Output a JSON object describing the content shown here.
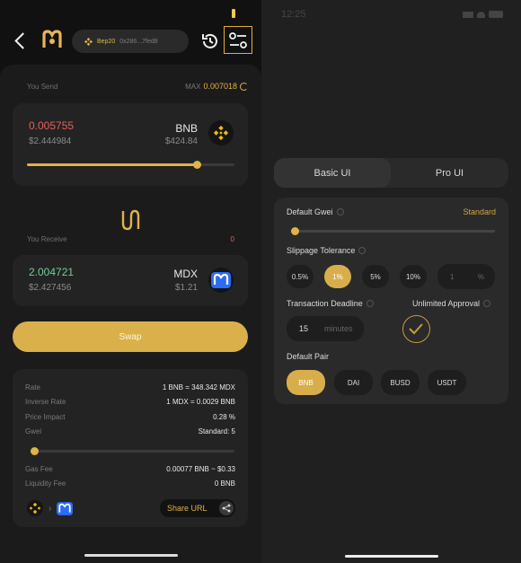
{
  "left": {
    "header": {
      "chain": "Bep20",
      "address": "0x286...7fed8"
    },
    "send": {
      "label": "You Send",
      "max_label": "MAX",
      "max_value": "0.007018",
      "amount": "0.005755",
      "usd_value": "$2.444984",
      "token": "BNB",
      "token_price": "$424.84",
      "slider_percent": 82
    },
    "receive": {
      "label": "You Receive",
      "count": "0",
      "amount": "2.004721",
      "usd_value": "$2.427456",
      "token": "MDX",
      "token_price": "$1.21"
    },
    "swap_label": "Swap",
    "details": {
      "rows": [
        {
          "key": "Rate",
          "value": "1 BNB = 348.342 MDX"
        },
        {
          "key": "Inverse Rate",
          "value": "1 MDX = 0.0029 BNB"
        },
        {
          "key": "Price Impact",
          "value": "0.28 %"
        },
        {
          "key": "Gwei",
          "value": "Standard: 5"
        },
        {
          "key": "Gas Fee",
          "value": "0.00077 BNB ~ $0.33"
        },
        {
          "key": "Liquidity Fee",
          "value": "0 BNB"
        }
      ],
      "gwei_slider_percent": 0,
      "share_label": "Share URL"
    }
  },
  "right": {
    "time": "12:25",
    "tabs": [
      {
        "label": "Basic UI",
        "active": true
      },
      {
        "label": "Pro UI",
        "active": false
      }
    ],
    "default_gwei": {
      "label": "Default Gwei",
      "value": "Standard",
      "slider_percent": 0
    },
    "slippage": {
      "label": "Slippage Tolerance",
      "options": [
        "0.5%",
        "1%",
        "5%",
        "10%"
      ],
      "selected": "1%",
      "custom_value": "1",
      "custom_unit": "%"
    },
    "deadline": {
      "label": "Transaction Deadline",
      "value": "15",
      "unit": "minutes"
    },
    "unlimited_approval": {
      "label": "Unlimited Approval",
      "checked": true
    },
    "default_pair": {
      "label": "Default Pair",
      "options": [
        "BNB",
        "DAI",
        "BUSD",
        "USDT"
      ],
      "selected": "BNB"
    }
  },
  "colors": {
    "accent": "#e0b247",
    "send_amount": "#e0625a",
    "receive_amount": "#6fcf97",
    "background": "#1b1b1b"
  }
}
